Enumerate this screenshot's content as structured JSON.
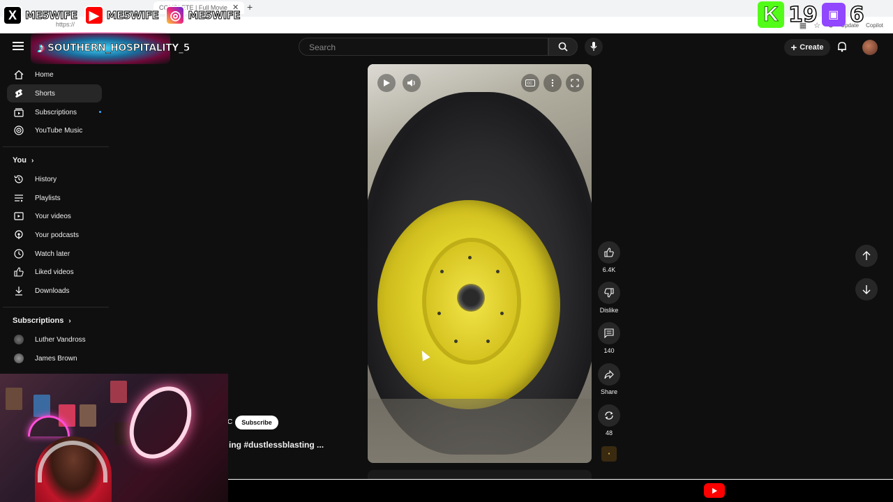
{
  "browser": {
    "tab_title": "COMPLETE | Full Movie",
    "url_fragment": "https://",
    "update_label": "Update",
    "copilot_label": "Copilot"
  },
  "overlay": {
    "x_name": "ME5WIFE",
    "youtube_name": "ME5WIFE",
    "instagram_name": "ME5WIFE",
    "tiktok_name": "SOUTHERN_HOSPITALITY_5",
    "kick_count": "19",
    "twitch_count": "6"
  },
  "header": {
    "search_placeholder": "Search",
    "create_label": "Create"
  },
  "sidebar": {
    "main": [
      {
        "label": "Home",
        "icon": "home-icon"
      },
      {
        "label": "Shorts",
        "icon": "shorts-icon"
      },
      {
        "label": "Subscriptions",
        "icon": "subscriptions-icon"
      },
      {
        "label": "YouTube Music",
        "icon": "music-icon"
      }
    ],
    "you_heading": "You",
    "you_items": [
      {
        "label": "History",
        "icon": "history-icon"
      },
      {
        "label": "Playlists",
        "icon": "playlists-icon"
      },
      {
        "label": "Your videos",
        "icon": "your-videos-icon"
      },
      {
        "label": "Your podcasts",
        "icon": "podcasts-icon"
      },
      {
        "label": "Watch later",
        "icon": "watch-later-icon"
      },
      {
        "label": "Liked videos",
        "icon": "like-icon"
      },
      {
        "label": "Downloads",
        "icon": "download-icon"
      }
    ],
    "subscriptions_heading": "Subscriptions",
    "subscriptions": [
      {
        "label": "Luther Vandross"
      },
      {
        "label": "James Brown"
      }
    ]
  },
  "short": {
    "channel_initial": "C",
    "subscribe_label": "Subscribe",
    "title": "ing #dustlessblasting ..."
  },
  "actions": {
    "likes": "6.4K",
    "dislike_label": "Dislike",
    "comments": "140",
    "share_label": "Share",
    "remix": "48"
  },
  "colors": {
    "background": "#0f0f0f",
    "accent_red": "#ff0000",
    "rim_yellow": "#e1d22a",
    "kick_green": "#53fc18",
    "twitch_purple": "#9146ff"
  }
}
